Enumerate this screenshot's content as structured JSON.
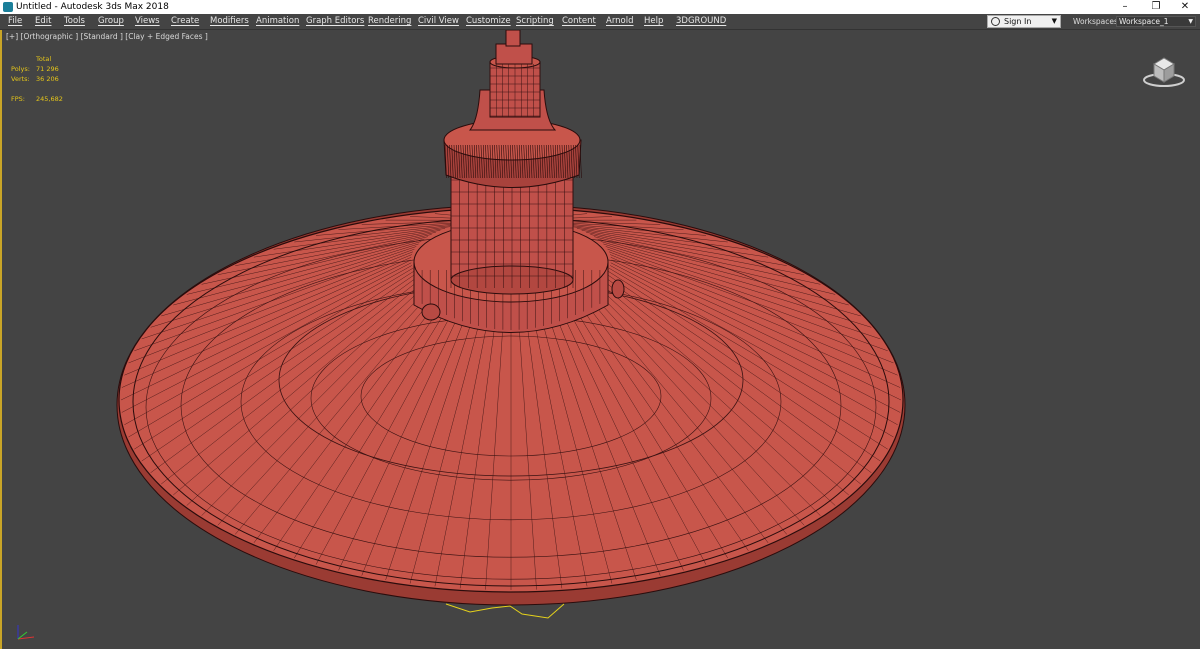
{
  "window": {
    "title": "Untitled - Autodesk 3ds Max 2018",
    "minimize": "–",
    "restore": "❐",
    "close": "✕"
  },
  "menu": [
    "File",
    "Edit",
    "Tools",
    "Group",
    "Views",
    "Create",
    "Modifiers",
    "Animation",
    "Graph Editors",
    "Rendering",
    "Civil View",
    "Customize",
    "Scripting",
    "Content",
    "Arnold",
    "Help",
    "3DGROUND"
  ],
  "account": {
    "signin_label": "Sign In",
    "dropdown_icon": "chevron-down-icon"
  },
  "workspaces": {
    "label": "Workspaces:",
    "value": "Workspace_1"
  },
  "viewport": {
    "label": "[+] [Orthographic ] [Standard ] [Clay + Edged Faces ]",
    "stats": {
      "header": "Total",
      "polys_label": "Polys:",
      "polys_value": "71 296",
      "verts_label": "Verts:",
      "verts_value": "36 206",
      "fps_label": "FPS:",
      "fps_value": "245,682"
    }
  },
  "colors": {
    "clay": "#c8564b",
    "wire": "#3a1212",
    "stats": "#e6c619",
    "active_border": "#c9a527"
  }
}
